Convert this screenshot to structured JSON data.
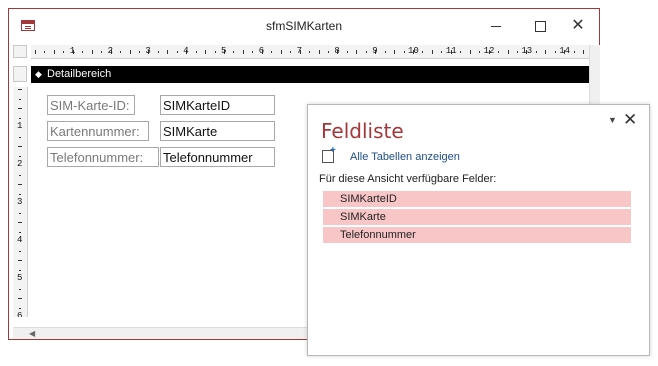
{
  "window": {
    "title": "sfmSIMKarten",
    "icon": "form-icon",
    "controls": {
      "minimize": "minimize-icon",
      "maximize": "maximize-icon",
      "close": "✕"
    }
  },
  "ruler": {
    "h_numbers": [
      "1",
      "2",
      "3",
      "4",
      "5",
      "6",
      "7",
      "8",
      "9",
      "10",
      "11",
      "12",
      "13",
      "14"
    ],
    "v_numbers": [
      "1",
      "2",
      "3",
      "4",
      "5",
      "6"
    ]
  },
  "section": {
    "label": "Detailbereich"
  },
  "form": {
    "labels": [
      "SIM-Karte-ID:",
      "Kartennummer:",
      "Telefonnummer:"
    ],
    "fields": [
      "SIMKarteID",
      "SIMKarte",
      "Telefonnummer"
    ]
  },
  "field_list": {
    "title": "Feldliste",
    "menu_icon": "▼",
    "close_icon": "✕",
    "show_all_label": "Alle Tabellen anzeigen",
    "available_label": "Für diese Ansicht verfügbare Felder:",
    "fields": [
      "SIMKarteID",
      "SIMKarte",
      "Telefonnummer"
    ]
  },
  "colors": {
    "accent": "#a4373a",
    "field_highlight": "#f9c6c7",
    "link": "#1f4e87"
  }
}
